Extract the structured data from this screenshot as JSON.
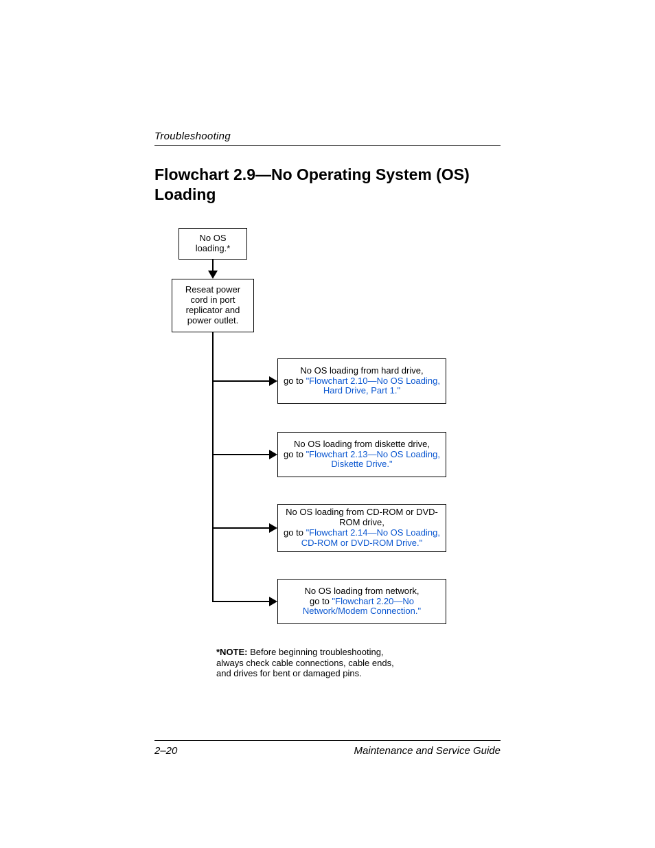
{
  "header": {
    "running_head": "Troubleshooting",
    "title": "Flowchart 2.9—No Operating System (OS) Loading"
  },
  "flow": {
    "start": "No OS loading.*",
    "reseat": "Reseat power cord in port replicator and power outlet.",
    "branches": [
      {
        "lead": "No OS loading from hard drive,",
        "goto_prefix": "go to ",
        "link": "\"Flowchart 2.10—No OS Loading, Hard Drive, Part 1.\""
      },
      {
        "lead": "No OS loading from diskette drive,",
        "goto_prefix": "go to ",
        "link": "\"Flowchart 2.13—No OS Loading, Diskette Drive.\""
      },
      {
        "lead": "No OS loading from CD-ROM or DVD-ROM drive,",
        "goto_prefix": "go to ",
        "link": "\"Flowchart 2.14—No OS Loading, CD-ROM or DVD-ROM Drive.\""
      },
      {
        "lead": "No OS loading from network,",
        "goto_prefix": "go to ",
        "link": "\"Flowchart 2.20—No Network/Modem Connection.\""
      }
    ]
  },
  "note": {
    "label": "*NOTE:",
    "text": " Before beginning troubleshooting, always check cable connections, cable ends, and drives for bent or damaged pins."
  },
  "footer": {
    "page": "2–20",
    "doc": "Maintenance and Service Guide"
  }
}
